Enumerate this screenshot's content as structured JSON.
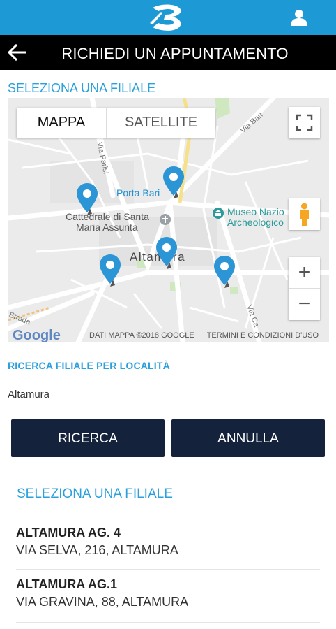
{
  "header": {
    "logo_icon": "brand-logo-icon",
    "user_icon": "user-icon",
    "background": "#1d9ad6"
  },
  "titlebar": {
    "back_icon": "arrow-left-icon",
    "title": "RICHIEDI UN APPUNTAMENTO"
  },
  "select_branch_label": "SELEZIONA UNA FILIALE",
  "map": {
    "maptype_map": "MAPPA",
    "maptype_satellite": "SATELLITE",
    "labels": {
      "porta_bari": "Porta Bari",
      "cattedrale_1": "Cattedrale di Santa",
      "cattedrale_2": "Maria Assunta",
      "museo_1": "Museo Nazio",
      "museo_2": "Archeologico",
      "city": "Altamura",
      "via_bari": "Via Bari",
      "via_parisi": "Via Parisi",
      "strada": "Strada",
      "via_ca": "Via Ca"
    },
    "google": "Google",
    "credits": "DATI MAPPA ©2018 GOOGLE",
    "terms": "TERMINI E CONDIZIONI D'USO",
    "zoom_in": "+",
    "zoom_out": "−",
    "pin_color": "#2b95d6"
  },
  "search": {
    "label": "RICERCA FILIALE PER LOCALITÀ",
    "value": "Altamura",
    "search_button": "RICERCA",
    "cancel_button": "ANNULLA"
  },
  "results": {
    "heading": "SELEZIONA UNA FILIALE",
    "items": [
      {
        "name": "ALTAMURA AG. 4",
        "address": "VIA SELVA, 216, ALTAMURA"
      },
      {
        "name": "ALTAMURA AG.1",
        "address": "VIA GRAVINA, 88, ALTAMURA"
      }
    ]
  }
}
